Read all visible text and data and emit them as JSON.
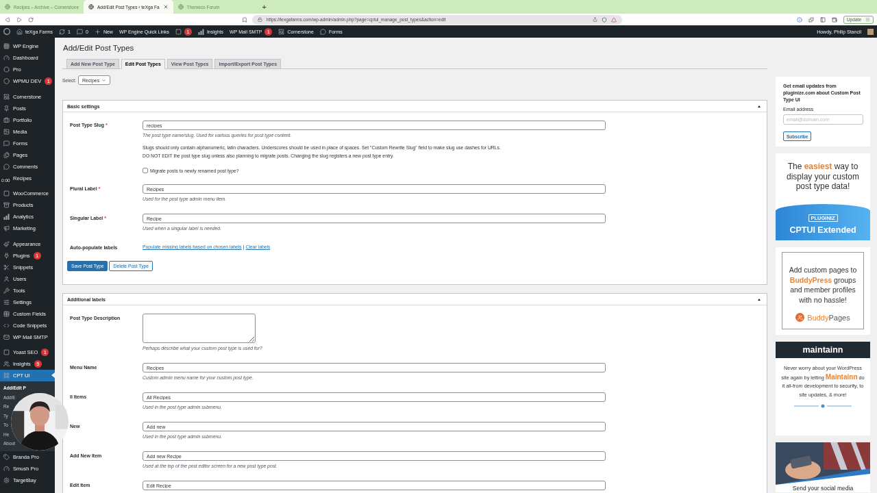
{
  "browser": {
    "tabs": [
      {
        "title": "Recipes – Archive – Cornerstone",
        "selected": false
      },
      {
        "title": "Add/Edit Post Types ‹ teXga Fa",
        "selected": true
      },
      {
        "title": "Themeco Forum",
        "selected": false
      }
    ],
    "new_tab": "+",
    "url": "https://texgafarms.com/wp-admin/admin.php?page=cptui_manage_post_types&action=edit",
    "update_button": "Update"
  },
  "admin_bar": {
    "items": [
      {
        "label": "teXga Farms"
      },
      {
        "label": "1"
      },
      {
        "label": "0"
      },
      {
        "label": "New"
      },
      {
        "label": "WP Engine Quick Links"
      },
      {
        "badge": "1"
      },
      {
        "label": "Insights"
      },
      {
        "label": "WP Mail SMTP",
        "badge": "1"
      },
      {
        "label": "Cornerstone"
      },
      {
        "label": "Forms"
      }
    ],
    "greeting": "Howdy, Philip Stancil"
  },
  "sidebar": {
    "groups": [
      [
        {
          "label": "WP Engine",
          "selected": false
        },
        {
          "label": "Dashboard",
          "selected": false
        },
        {
          "label": "Pro",
          "selected": false
        },
        {
          "label": "WPMU DEV",
          "badge": "1",
          "selected": false
        }
      ],
      [
        {
          "label": "Cornerstone",
          "selected": false
        },
        {
          "label": "Posts",
          "selected": false
        },
        {
          "label": "Portfolio",
          "selected": false
        },
        {
          "label": "Media",
          "selected": false
        },
        {
          "label": "Forms",
          "selected": false
        },
        {
          "label": "Pages",
          "selected": false
        },
        {
          "label": "Comments",
          "selected": false
        },
        {
          "label": "Recipes",
          "selected": false
        }
      ],
      [
        {
          "label": "WooCommerce",
          "selected": false
        },
        {
          "label": "Products",
          "selected": false
        },
        {
          "label": "Analytics",
          "selected": false
        },
        {
          "label": "Marketing",
          "selected": false
        }
      ],
      [
        {
          "label": "Appearance",
          "selected": false
        },
        {
          "label": "Plugins",
          "badge": "1",
          "selected": false
        },
        {
          "label": "Snippets",
          "selected": false
        },
        {
          "label": "Users",
          "selected": false
        },
        {
          "label": "Tools",
          "selected": false
        },
        {
          "label": "Settings",
          "selected": false
        },
        {
          "label": "Custom Fields",
          "selected": false
        },
        {
          "label": "Code Snippets",
          "selected": false
        },
        {
          "label": "WP Mail SMTP",
          "selected": false
        }
      ],
      [
        {
          "label": "Yoast SEO",
          "badge": "1",
          "selected": false
        },
        {
          "label": "Insights",
          "badge": "5",
          "selected": false
        },
        {
          "label": "CPT UI",
          "selected": true,
          "children": [
            {
              "label": "Add/Edit P",
              "selected": true
            },
            {
              "label": "Add/E",
              "selected": false
            },
            {
              "label": "Re",
              "selected": false
            },
            {
              "label": "Ty",
              "selected": false
            },
            {
              "label": "To",
              "selected": false
            },
            {
              "label": "He",
              "selected": false
            },
            {
              "label": "About",
              "selected": false
            }
          ]
        },
        {
          "label": "Branda Pro",
          "selected": false
        },
        {
          "label": "Smush Pro",
          "selected": false
        },
        {
          "label": "TargetBay",
          "selected": false
        }
      ]
    ]
  },
  "video": {
    "timestamp": "0:00"
  },
  "page": {
    "title": "Add/Edit Post Types",
    "tabs": [
      {
        "label": "Add New Post Type",
        "selected": false
      },
      {
        "label": "Edit Post Types",
        "selected": true
      },
      {
        "label": "View Post Types",
        "selected": false
      },
      {
        "label": "Import/Export Post Types",
        "selected": false
      }
    ],
    "select": {
      "label": "Select:",
      "value": "Recipes"
    },
    "panels": [
      {
        "title": "Basic settings",
        "expanded": true,
        "fields": [
          {
            "kind": "text",
            "label": "Post Type Slug",
            "required_mark": "*",
            "value": "recipes",
            "help": "The post type name/slug. Used for various queries for post type content.",
            "notes": [
              "Slugs should only contain alphanumeric, latin characters. Underscores should be used in place of spaces. Set \"Custom Rewrite Slug\" field to make slug use dashes for URLs.",
              "DO NOT EDIT the post type slug unless also planning to migrate posts. Changing the slug registers a new post type entry."
            ],
            "checkbox": {
              "label": "Migrate posts to newly renamed post type?",
              "checked": false
            }
          },
          {
            "kind": "text",
            "label": "Plural Label",
            "required_mark": "*",
            "value": "Recipes",
            "help": "Used for the post type admin menu item."
          },
          {
            "kind": "text",
            "label": "Singular Label",
            "required_mark": "*",
            "value": "Recipe",
            "help": "Used when a singular label is needed."
          },
          {
            "kind": "links",
            "label": "Auto-populate labels",
            "links": [
              "Populate missing labels based on chosen labels",
              "Clear labels"
            ],
            "separator": "|"
          }
        ],
        "buttons": [
          {
            "label": "Save Post Type",
            "kind": "primary"
          },
          {
            "label": "Delete Post Type",
            "kind": "secondary"
          }
        ]
      },
      {
        "title": "Additional labels",
        "expanded": true,
        "fields": [
          {
            "kind": "textarea",
            "label": "Post Type Description",
            "help": "Perhaps describe what your custom post type is used for?"
          },
          {
            "kind": "text",
            "label": "Menu Name",
            "value": "Recipes",
            "help": "Custom admin menu name for your custom post type."
          },
          {
            "kind": "text",
            "label": "ll Items",
            "value": "All Recipes",
            "help": "Used in the post type admin submenu."
          },
          {
            "kind": "text",
            "label": "New",
            "value": "Add new",
            "help": "Used in the post type admin submenu."
          },
          {
            "kind": "text",
            "label": "Add New Item",
            "value": "Add new Recipe",
            "help": "Used at the top of the post editor screen for a new post type post."
          },
          {
            "kind": "text",
            "label": "Edit Item",
            "value": "Edit Recipe"
          }
        ]
      }
    ]
  },
  "aside": {
    "subscribe": {
      "text": "Get email updates from pluginize.com about Custom Post Type UI",
      "email_label": "Email address",
      "placeholder": "email@domain.com",
      "button": "Subscribe"
    },
    "ads": [
      {
        "kind": "cptui",
        "headline": "The **easiest** way to display your custom post type data!",
        "badge": "PLUGINIZ",
        "product": "CPTUI Extended"
      },
      {
        "kind": "buddypages",
        "headline": "Add custom pages to **BuddyPress** groups and member profiles with no hassle!",
        "logo": "**Buddy**Pages"
      },
      {
        "kind": "maintainn",
        "header": "maintainn",
        "text": "Never worry about your WordPress site again by letting **Maintainn** do it all-from development to security, to site updates, & more!"
      },
      {
        "caption": "Send your social media"
      }
    ]
  }
}
